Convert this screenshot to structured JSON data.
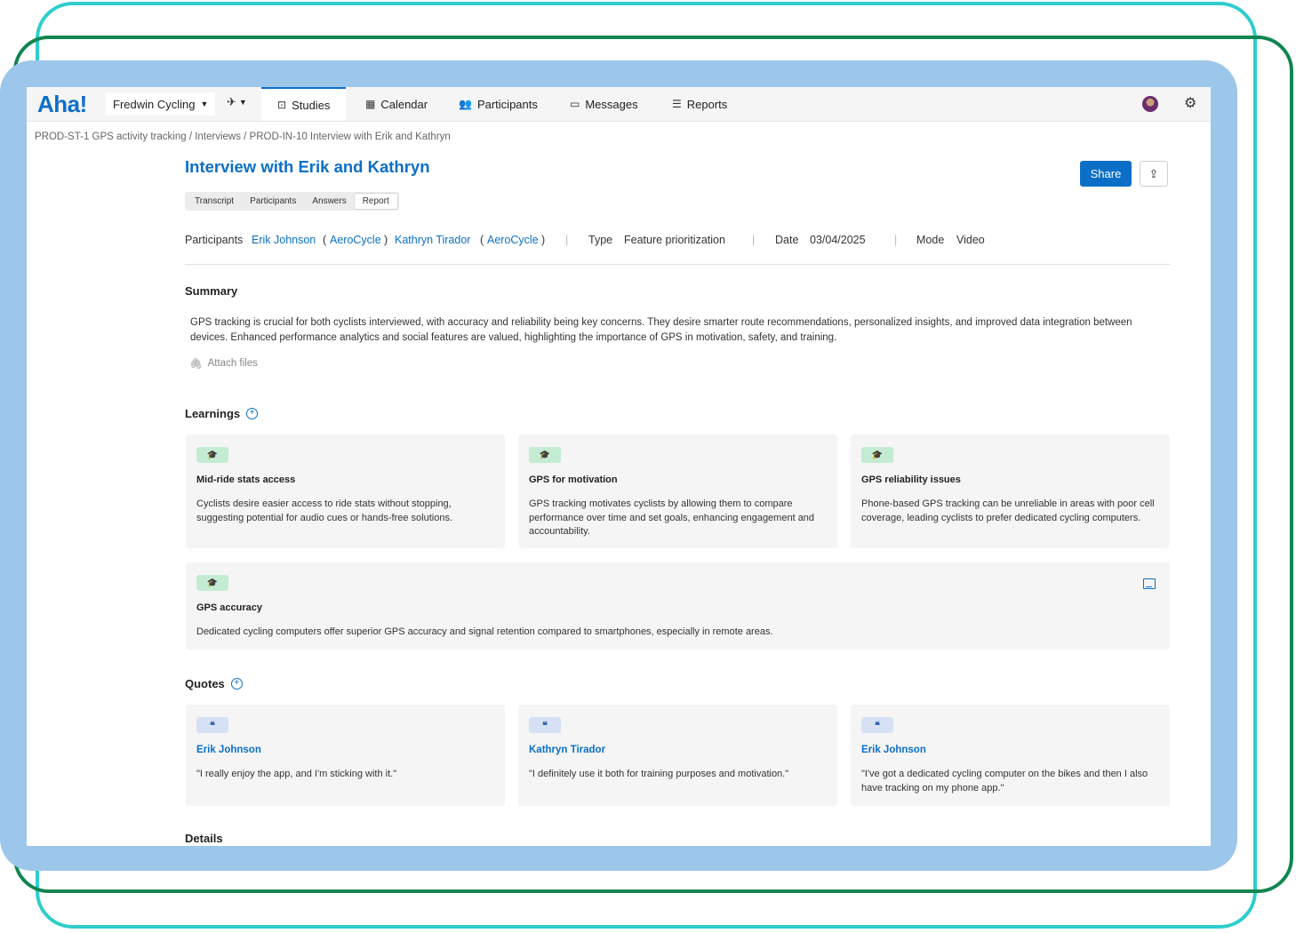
{
  "app": {
    "logo": "Aha!",
    "workspace": "Fredwin Cycling",
    "nav_tabs": [
      {
        "label": "Studies",
        "icon": "studies-icon",
        "active": true
      },
      {
        "label": "Calendar",
        "icon": "calendar-icon",
        "active": false
      },
      {
        "label": "Participants",
        "icon": "participants-icon",
        "active": false
      },
      {
        "label": "Messages",
        "icon": "messages-icon",
        "active": false
      },
      {
        "label": "Reports",
        "icon": "reports-icon",
        "active": false
      }
    ]
  },
  "breadcrumb": "PROD-ST-1 GPS activity tracking / Interviews / PROD-IN-10 Interview with Erik and Kathryn",
  "page": {
    "title": "Interview with Erik and Kathryn",
    "share_label": "Share",
    "subtabs": [
      "Transcript",
      "Participants",
      "Answers",
      "Report"
    ],
    "active_subtab": "Report"
  },
  "meta": {
    "participants_label": "Participants",
    "participant_1": "Erik Johnson",
    "company_1": "AeroCycle",
    "participant_2": "Kathryn Tirador",
    "company_2": "AeroCycle",
    "type_label": "Type",
    "type_value": "Feature prioritization",
    "date_label": "Date",
    "date_value": "03/04/2025",
    "mode_label": "Mode",
    "mode_value": "Video"
  },
  "summary": {
    "title": "Summary",
    "text": "GPS tracking is crucial for both cyclists interviewed, with accuracy and reliability being key concerns. They desire smarter route recommendations, personalized insights, and improved data integration between devices. Enhanced performance analytics and social features are valued, highlighting the importance of GPS in motivation, safety, and training.",
    "attach_label": "Attach files"
  },
  "learnings": {
    "title": "Learnings",
    "items": [
      {
        "title": "Mid-ride stats access",
        "body": "Cyclists desire easier access to ride stats without stopping, suggesting potential for audio cues or hands-free solutions."
      },
      {
        "title": "GPS for motivation",
        "body": "GPS tracking motivates cyclists by allowing them to compare performance over time and set goals, enhancing engagement and accountability."
      },
      {
        "title": "GPS reliability issues",
        "body": "Phone-based GPS tracking can be unreliable in areas with poor cell coverage, leading cyclists to prefer dedicated cycling computers."
      },
      {
        "title": "GPS accuracy",
        "body": "Dedicated cycling computers offer superior GPS accuracy and signal retention compared to smartphones, especially in remote areas."
      }
    ]
  },
  "quotes": {
    "title": "Quotes",
    "items": [
      {
        "person": "Erik Johnson",
        "text": "\"I really enjoy the app, and I'm sticking with it.\""
      },
      {
        "person": "Kathryn Tirador",
        "text": "\"I definitely use it both for training purposes and motivation.\""
      },
      {
        "person": "Erik Johnson",
        "text": "\"I've got a dedicated cycling computer on the bikes and then I also have tracking on my phone app.\""
      }
    ]
  },
  "details": {
    "title": "Details"
  },
  "colors": {
    "accent": "#0b6fc7",
    "frame_teal": "#2fcdcd",
    "frame_green": "#10854f",
    "frame_blue": "#9cc6ea"
  }
}
